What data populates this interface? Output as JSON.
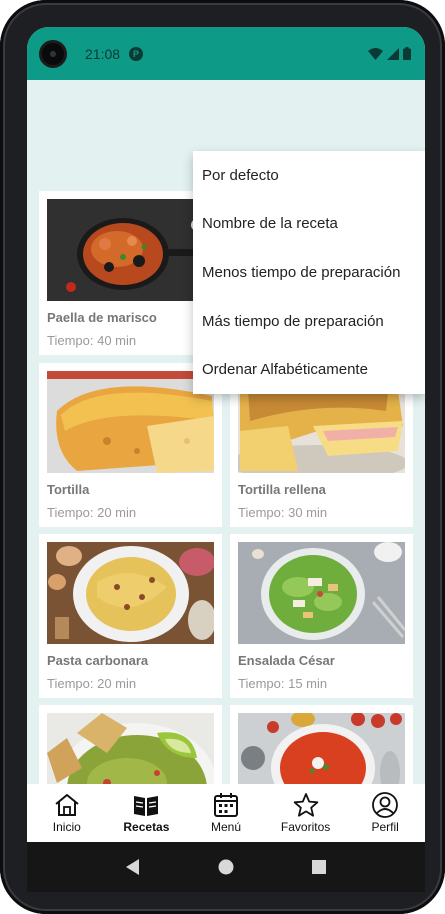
{
  "status": {
    "time": "21:08",
    "app_icon_letter": "P"
  },
  "sort_menu": {
    "items": [
      "Por defecto",
      "Nombre de la receta",
      "Menos tiempo de preparación",
      "Más tiempo de preparación",
      "Ordenar Alfabéticamente"
    ]
  },
  "recipes": [
    {
      "name": "Paella de marisco",
      "time": "Tiempo: 40 min"
    },
    {
      "name": "",
      "time": ""
    },
    {
      "name": "Tortilla",
      "time": "Tiempo: 20 min"
    },
    {
      "name": "Tortilla rellena",
      "time": "Tiempo: 30 min"
    },
    {
      "name": "Pasta carbonara",
      "time": "Tiempo: 20 min"
    },
    {
      "name": "Ensalada César",
      "time": "Tiempo: 15 min"
    },
    {
      "name": "",
      "time": ""
    },
    {
      "name": "",
      "time": ""
    }
  ],
  "nav": {
    "items": [
      {
        "label": "Inicio",
        "icon": "home-icon"
      },
      {
        "label": "Recetas",
        "icon": "book-icon",
        "active": true
      },
      {
        "label": "Menú",
        "icon": "calendar-icon"
      },
      {
        "label": "Favoritos",
        "icon": "star-icon"
      },
      {
        "label": "Perfil",
        "icon": "profile-icon"
      }
    ]
  },
  "colors": {
    "status_bar": "#0d9b88",
    "background": "#e3f2f1",
    "card": "#ffffff",
    "menu": "#ffffff"
  }
}
